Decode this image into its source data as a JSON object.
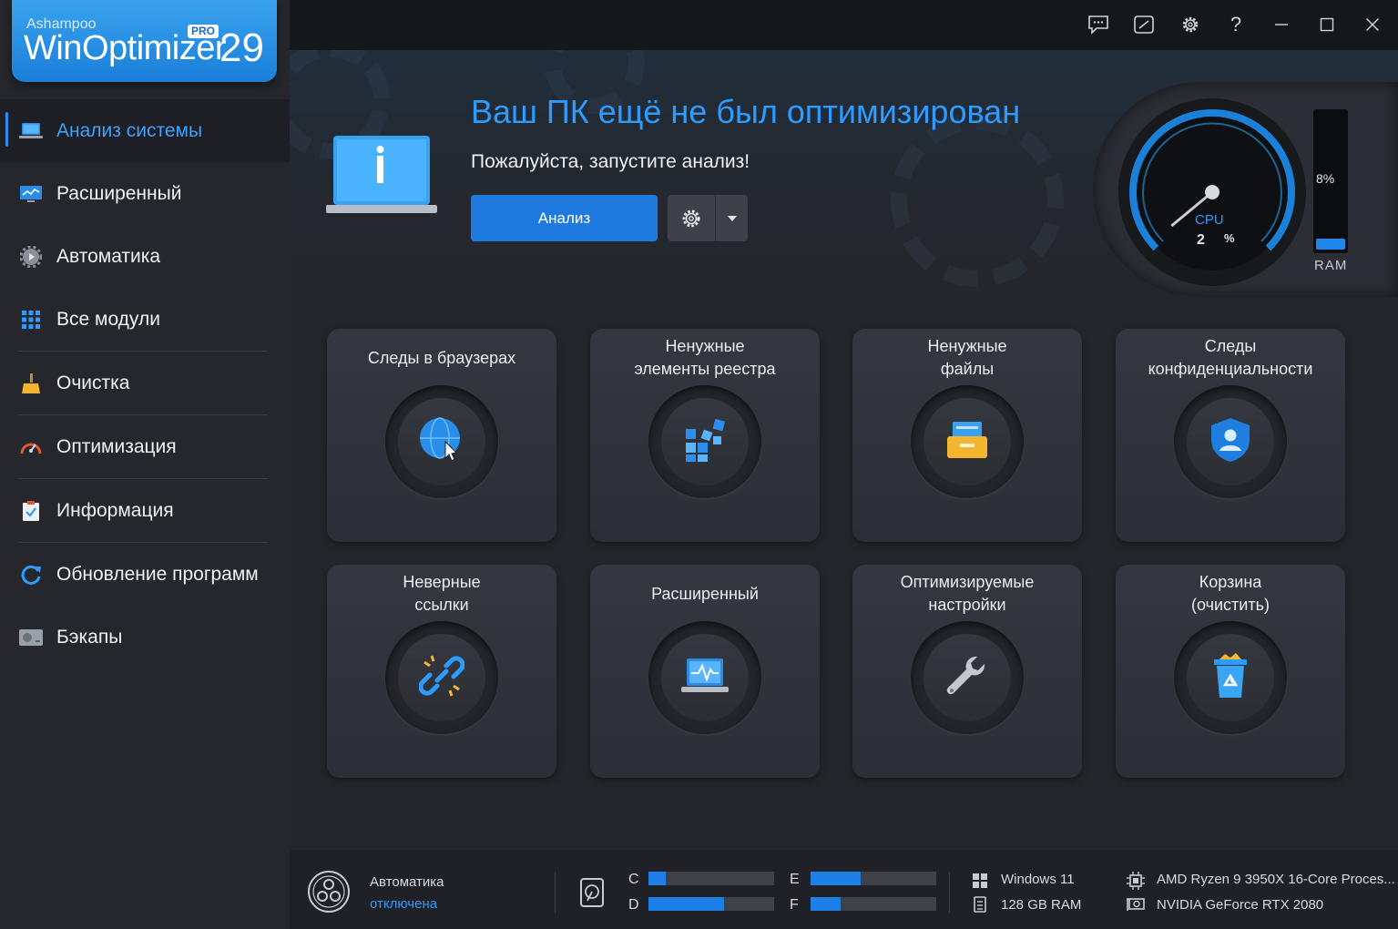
{
  "logo": {
    "brand": "Ashampoo",
    "product": "WinOptimizer",
    "badge": "PRO",
    "version": "29"
  },
  "sidebar": {
    "items": [
      {
        "label": "Анализ системы",
        "icon": "laptop-icon",
        "active": true
      },
      {
        "label": "Расширенный",
        "icon": "monitor-chart-icon"
      },
      {
        "label": "Автоматика",
        "icon": "gear-play-icon"
      },
      {
        "label": "Все модули",
        "icon": "grid-icon"
      },
      {
        "label": "Очистка",
        "icon": "broom-icon"
      },
      {
        "label": "Оптимизация",
        "icon": "speedometer-icon"
      },
      {
        "label": "Информация",
        "icon": "clipboard-check-icon"
      },
      {
        "label": "Обновление программ",
        "icon": "refresh-icon"
      },
      {
        "label": "Бэкапы",
        "icon": "hard-drive-icon"
      }
    ]
  },
  "titlebar": {
    "buttons": [
      "feedback-icon",
      "screenshot-icon",
      "settings-icon",
      "help-icon",
      "minimize-icon",
      "maximize-icon",
      "close-icon"
    ]
  },
  "hero": {
    "title": "Ваш ПК ещё не был оптимизирован",
    "subtitle": "Пожалуйста, запустите анализ!",
    "analyze_label": "Анализ"
  },
  "gauge": {
    "cpu_label": "CPU",
    "cpu_value": "2",
    "cpu_unit": "%",
    "cpu_level": 0.02,
    "ram_label": "RAM",
    "ram_value": "8%",
    "ram_level": 0.08
  },
  "tiles": [
    {
      "label": "Следы в браузерах",
      "icon": "globe-cursor-icon"
    },
    {
      "label": "Ненужные\nэлементы реестра",
      "icon": "registry-blocks-icon"
    },
    {
      "label": "Ненужные\nфайлы",
      "icon": "file-tray-icon"
    },
    {
      "label": "Следы\nконфиденциальности",
      "icon": "shield-user-icon"
    },
    {
      "label": "Неверные\nссылки",
      "icon": "broken-link-icon"
    },
    {
      "label": "Расширенный",
      "icon": "laptop-pulse-icon"
    },
    {
      "label": "Оптимизируемые\nнастройки",
      "icon": "wrench-icon"
    },
    {
      "label": "Корзина\n(очистить)",
      "icon": "recycle-bin-icon"
    }
  ],
  "status": {
    "automation_title": "Автоматика",
    "automation_state": "отключена",
    "drives": [
      {
        "letter": "C",
        "used": 0.14
      },
      {
        "letter": "D",
        "used": 0.6
      },
      {
        "letter": "E",
        "used": 0.4
      },
      {
        "letter": "F",
        "used": 0.24
      }
    ],
    "os": "Windows 11",
    "ram": "128 GB RAM",
    "cpu": "AMD Ryzen 9 3950X 16-Core Proces...",
    "gpu": "NVIDIA GeForce RTX 2080"
  },
  "colors": {
    "accent": "#2e9bff",
    "button": "#1f7ae0",
    "bar": "#1e7fe6"
  }
}
